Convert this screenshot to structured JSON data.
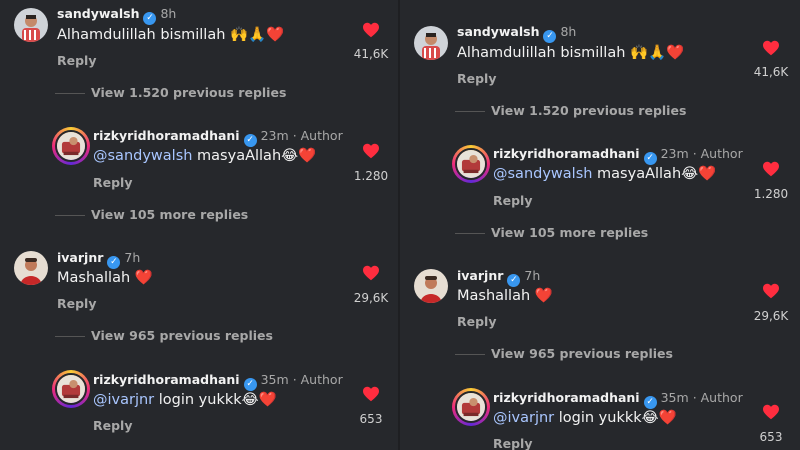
{
  "comments": [
    {
      "username": "sandywalsh",
      "time": "8h",
      "author_tag": "",
      "mention": "",
      "text": "Alhamdulillah bismillah",
      "emojis": "🙌🙏❤️",
      "reply": "Reply",
      "likes": "41,6K"
    },
    {
      "view_replies": "View 1.520 previous replies"
    },
    {
      "username": "rizkyridhoramadhani",
      "time": "23m",
      "author_tag": "· Author",
      "mention": "@sandywalsh",
      "text": " masyaAllah",
      "emojis": "😂❤️",
      "reply": "Reply",
      "likes": "1.280"
    },
    {
      "view_replies": "View 105 more replies"
    },
    {
      "username": "ivarjnr",
      "time": "7h",
      "author_tag": "",
      "mention": "",
      "text": "Mashallah",
      "emojis": "❤️",
      "reply": "Reply",
      "likes": "29,6K"
    },
    {
      "view_replies": "View 965 previous replies"
    },
    {
      "username": "rizkyridhoramadhani",
      "time": "35m",
      "author_tag": "· Author",
      "mention": "@ivarjnr",
      "text": " login yukkk",
      "emojis": "😂❤️",
      "reply": "Reply",
      "likes": "653"
    }
  ],
  "colors": {
    "background": "#26282c",
    "heart": "#ff2d3f",
    "mention": "#a9c6ff",
    "verified": "#3897f0"
  }
}
